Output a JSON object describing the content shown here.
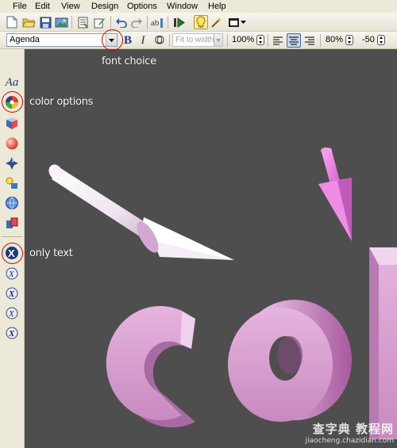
{
  "menu": {
    "items": [
      {
        "label": "File"
      },
      {
        "label": "Edit"
      },
      {
        "label": "View"
      },
      {
        "label": "Design"
      },
      {
        "label": "Options"
      },
      {
        "label": "Window"
      },
      {
        "label": "Help"
      }
    ]
  },
  "format_toolbar": {
    "font_name": "Agenda",
    "bold_label": "B",
    "italic_label": "I",
    "outline_label": "O",
    "fit_mode": "Fit to width",
    "scale": "100%",
    "width_percent": "80%",
    "spacing": "-50"
  },
  "annotations": {
    "font_choice": "font choice",
    "color_options": "color options",
    "only_text": "only text"
  },
  "panel": {
    "text_tool_label": "Aa"
  },
  "watermark": {
    "title": "查字典 教程网",
    "url": "jiaocheng.chazidian.com"
  },
  "colors": {
    "canvas_bg": "#4e4e4e",
    "letter_pink": "#d896d0",
    "arrow_white": "#f4eef4",
    "arrow_pink": "#ee88e6",
    "annotation_red": "#d40000"
  }
}
